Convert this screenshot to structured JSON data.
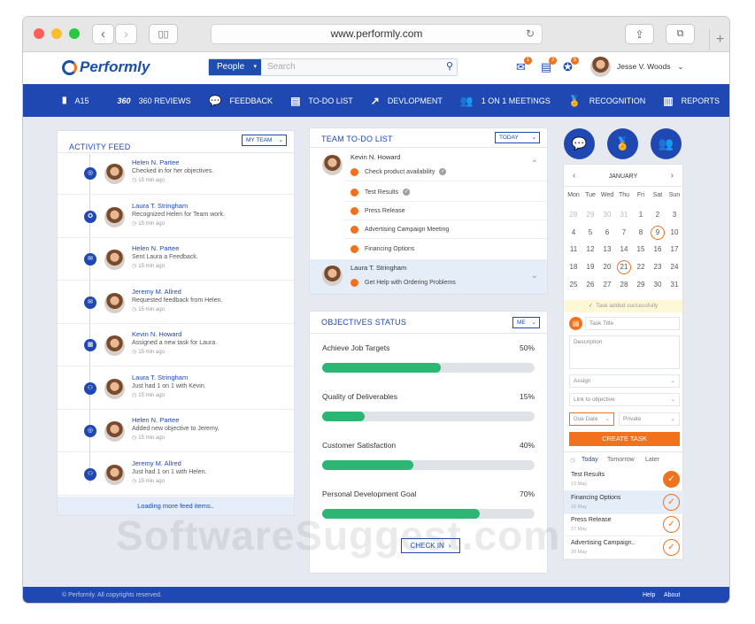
{
  "browser": {
    "url": "www.performly.com"
  },
  "app": {
    "logo": "Performly",
    "search": {
      "select": "People",
      "placeholder": "Search"
    },
    "notifications": [
      "1",
      "3",
      "5"
    ],
    "user": "Jesse V. Woods"
  },
  "nav": {
    "account": "A15",
    "items": [
      {
        "icon": "360",
        "label": "360 REVIEWS"
      },
      {
        "icon": "💬",
        "label": "FEEDBACK"
      },
      {
        "icon": "▤",
        "label": "TO-DO LIST"
      },
      {
        "icon": "↗",
        "label": "DEVLOPMENT"
      },
      {
        "icon": "👥",
        "label": "1 ON 1 MEETINGS"
      },
      {
        "icon": "🏅",
        "label": "RECOGNITION"
      },
      {
        "icon": "▥",
        "label": "REPORTS"
      }
    ]
  },
  "activity_feed": {
    "title": "ACTIVITY FEED",
    "filter": "MY TEAM",
    "loading": "Loading more feed items..",
    "items": [
      {
        "name": "Helen N. Partee",
        "text": "Checked in for her objectives.",
        "time": "15 min ago",
        "icon": "◎"
      },
      {
        "name": "Laura T. Stringham",
        "text": "Recognized Helen for Team work.",
        "time": "15 min ago",
        "icon": "✪"
      },
      {
        "name": "Helen N. Partee",
        "text": "Sent Laura a Feedback.",
        "time": "15 min ago",
        "icon": "✉"
      },
      {
        "name": "Jeremy M. Allred",
        "text": "Requested feedback from Helen.",
        "time": "15 min ago",
        "icon": "✉"
      },
      {
        "name": "Kevin N. Howard",
        "text": "Assigned a new task for Laura.",
        "time": "15 min ago",
        "icon": "▦"
      },
      {
        "name": "Laura T. Stringham",
        "text": "Just had 1 on 1 with Kevin.",
        "time": "15 min ago",
        "icon": "⚇"
      },
      {
        "name": "Helen N. Partee",
        "text": "Added new objective to Jeremy.",
        "time": "15 min ago",
        "icon": "◎"
      },
      {
        "name": "Jeremy M. Allred",
        "text": "Just had 1 on 1 with Helen.",
        "time": "15 min ago",
        "icon": "⚇"
      }
    ]
  },
  "team_todo": {
    "title": "TEAM TO-DO LIST",
    "filter": "TODAY",
    "person1": {
      "name": "Kevin N. Howard",
      "task": "Check product availability"
    },
    "subtasks": [
      "Test Results",
      "Press Release",
      "Advertising Campaign Meeting",
      "Financing Options"
    ],
    "person2": {
      "name": "Laura T. Stringham",
      "task": "Get Help with Ordering Problems"
    }
  },
  "objectives": {
    "title": "OBJECTIVES STATUS",
    "filter": "ME",
    "items": [
      {
        "name": "Achieve Job Targets",
        "percent": "50%",
        "value": 0.56
      },
      {
        "name": "Quality of Deliverables",
        "percent": "15%",
        "value": 0.2
      },
      {
        "name": "Customer Satisfaction",
        "percent": "40%",
        "value": 0.43
      },
      {
        "name": "Personal Development Goal",
        "percent": "70%",
        "value": 0.74
      }
    ],
    "checkin": "CHECK IN"
  },
  "calendar": {
    "month": "JANUARY",
    "weekdays": [
      "Mon",
      "Tue",
      "Wed",
      "Thu",
      "Fri",
      "Sat",
      "Sun"
    ],
    "days": [
      [
        "28",
        "29",
        "30",
        "31",
        "1",
        "2",
        "3"
      ],
      [
        "4",
        "5",
        "6",
        "7",
        "8",
        "9",
        "10"
      ],
      [
        "11",
        "12",
        "13",
        "14",
        "15",
        "16",
        "17"
      ],
      [
        "18",
        "19",
        "20",
        "21",
        "22",
        "23",
        "24"
      ],
      [
        "25",
        "26",
        "27",
        "28",
        "29",
        "30",
        "31"
      ]
    ],
    "success": "Task added successfully"
  },
  "task_form": {
    "title_ph": "Task Title",
    "desc_ph": "Description",
    "assign": "Assign",
    "link": "Link to objective",
    "due": "Due Date",
    "privacy": "Private",
    "create": "CREATE TASK"
  },
  "tasks": {
    "tabs": [
      "Today",
      "Tomorrow",
      "Later"
    ],
    "items": [
      {
        "name": "Test Results",
        "date": "13 May"
      },
      {
        "name": "Financing Options",
        "date": "15 May"
      },
      {
        "name": "Press Release",
        "date": "17 May"
      },
      {
        "name": "Advertising Campaign..",
        "date": "20 May"
      }
    ]
  },
  "footer": {
    "copyright": "© Performly. All copyrights reserved.",
    "help": "Help",
    "about": "About"
  },
  "watermark": "SoftwareSuggest.com",
  "colors": {
    "primary": "#1f48b3",
    "accent": "#f2711c",
    "progress": "#2bb673"
  }
}
